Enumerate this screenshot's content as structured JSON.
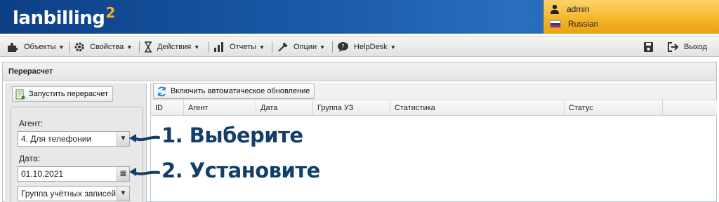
{
  "header": {
    "logo_text": "lanbilling",
    "logo_sup": "2",
    "user": "admin",
    "language": "Russian"
  },
  "menu": {
    "items": [
      {
        "label": "Объекты",
        "icon": "puzzle-icon"
      },
      {
        "label": "Свойства",
        "icon": "gear-icon"
      },
      {
        "label": "Действия",
        "icon": "hourglass-icon"
      },
      {
        "label": "Отчеты",
        "icon": "bar-chart-icon"
      },
      {
        "label": "Опции",
        "icon": "wrench-icon"
      },
      {
        "label": "HelpDesk",
        "icon": "speech-bubble-icon"
      }
    ],
    "logout_label": "Выход"
  },
  "panel": {
    "title": "Перерасчет",
    "run_button": "Запустить перерасчет",
    "agent_label": "Агент:",
    "agent_value": "4. Для телефонии",
    "date_label": "Дата:",
    "date_value": "01.10.2021",
    "group_value": "Группа учётных записей"
  },
  "grid": {
    "refresh_button": "Включить автоматическое обновление",
    "columns": [
      "ID",
      "Агент",
      "Дата",
      "Группа УЗ",
      "Статистика",
      "Статус"
    ]
  },
  "annotations": {
    "step1": "1. Выберите",
    "step2": "2. Установите"
  },
  "colors": {
    "header_blue": "#1a5aa8",
    "userbox_orange": "#f5b62c",
    "annotation": "#123e6a"
  }
}
